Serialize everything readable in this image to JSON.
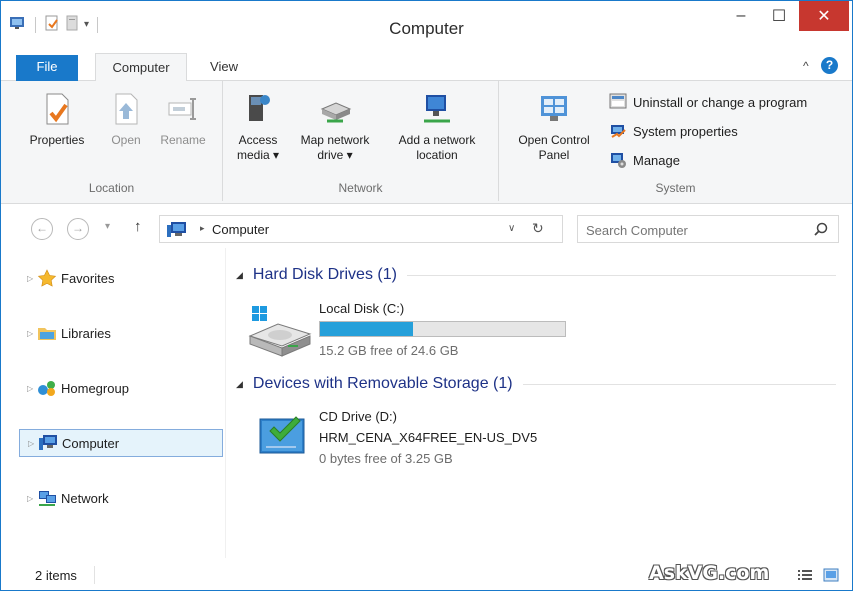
{
  "window": {
    "title": "Computer",
    "controls": {
      "minimize": "–",
      "maximize": "☐",
      "close": "✕"
    }
  },
  "quick_access": [
    "properties-icon",
    "new-folder-icon",
    "document-icon",
    "customize-dropdown"
  ],
  "ribbon": {
    "tabs": [
      {
        "label": "File",
        "active": false
      },
      {
        "label": "Computer",
        "active": true
      },
      {
        "label": "View",
        "active": false
      }
    ],
    "collapse_glyph": "^",
    "help_glyph": "?",
    "groups": [
      {
        "label": "Location",
        "buttons": [
          {
            "label": "Properties",
            "icon": "properties-icon",
            "enabled": true
          },
          {
            "label": "Open",
            "icon": "open-icon",
            "enabled": false
          },
          {
            "label": "Rename",
            "icon": "rename-icon",
            "enabled": false
          }
        ]
      },
      {
        "label": "Network",
        "buttons": [
          {
            "line1": "Access",
            "line2": "media ▾",
            "icon": "access-media-icon"
          },
          {
            "line1": "Map network",
            "line2": "drive ▾",
            "icon": "map-drive-icon"
          },
          {
            "line1": "Add a network",
            "line2": "location",
            "icon": "add-network-location-icon"
          }
        ]
      },
      {
        "label": "System",
        "buttons": [
          {
            "line1": "Open Control",
            "line2": "Panel",
            "icon": "control-panel-icon"
          }
        ],
        "items": [
          {
            "label": "Uninstall or change a program",
            "icon": "uninstall-icon"
          },
          {
            "label": "System properties",
            "icon": "system-properties-icon"
          },
          {
            "label": "Manage",
            "icon": "manage-icon"
          }
        ]
      }
    ]
  },
  "navigation": {
    "back": "←",
    "forward": "→",
    "recent": "▾",
    "up": "↑",
    "address": {
      "separator": "▸",
      "path": "Computer",
      "dropdown": "∨",
      "refresh": "↻"
    },
    "search": {
      "placeholder": "Search Computer",
      "value": ""
    }
  },
  "nav_pane": {
    "items": [
      {
        "label": "Favorites",
        "icon": "star-icon",
        "selected": false
      },
      {
        "label": "Libraries",
        "icon": "libraries-icon",
        "selected": false
      },
      {
        "label": "Homegroup",
        "icon": "homegroup-icon",
        "selected": false
      },
      {
        "label": "Computer",
        "icon": "computer-icon",
        "selected": true
      },
      {
        "label": "Network",
        "icon": "network-icon",
        "selected": false
      }
    ]
  },
  "content": {
    "sections": [
      {
        "title": "Hard Disk Drives (1)",
        "drives": [
          {
            "name": "Local Disk (C:)",
            "free_text": "15.2 GB free of 24.6 GB",
            "used_fraction": 0.38,
            "icon": "hard-disk-icon"
          }
        ]
      },
      {
        "title": "Devices with Removable Storage (1)",
        "drives": [
          {
            "name": "CD Drive (D:)",
            "label": "HRM_CENA_X64FREE_EN-US_DV5",
            "free_text": "0 bytes free of 3.25 GB",
            "icon": "cd-drive-icon"
          }
        ]
      }
    ]
  },
  "status": {
    "count": "2 items",
    "watermark": "AskVG.com"
  },
  "colors": {
    "accent": "#1979ca",
    "close_button": "#c7372f",
    "section_heading": "#1e3287",
    "progress_fill": "#26a0da",
    "selection_bg": "#e5f3fb"
  }
}
